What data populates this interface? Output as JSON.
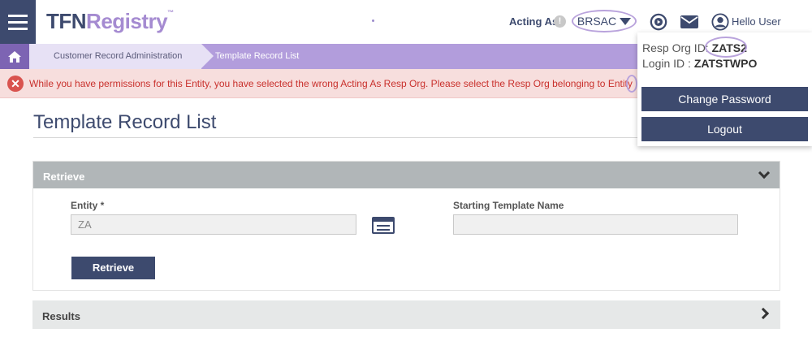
{
  "header": {
    "logo_tfn": "TFN",
    "logo_registry": "Registry",
    "logo_tm": "™",
    "acting_as_label": "Acting As",
    "acting_as_info": "!",
    "acting_as_value": "BRSAC",
    "greeting": "Hello User",
    "icons": [
      "menu-icon",
      "play-circle-icon",
      "mail-icon",
      "user-icon",
      "info-icon",
      "chevron-down-icon"
    ]
  },
  "breadcrumb": {
    "home_icon": "home-icon",
    "items": [
      "Customer Record Administration",
      "Template Record List"
    ]
  },
  "alert": {
    "icon": "close-circle-icon",
    "message": "While you have permissions for this Entity, you have selected the wrong Acting As Resp Org. Please select the Resp Org belonging to Entity ZA."
  },
  "user_menu": {
    "resp_org_label": "Resp Org ID:",
    "resp_org_value": "ZATS2",
    "login_label": "Login ID :",
    "login_value": "ZATSTWPO",
    "change_password": "Change Password",
    "logout": "Logout"
  },
  "main": {
    "title": "Template Record List",
    "retrieve_panel": {
      "title": "Retrieve",
      "entity_label": "Entity *",
      "entity_value": "ZA",
      "starting_template_label": "Starting Template Name",
      "starting_template_value": "",
      "retrieve_button": "Retrieve"
    },
    "results_panel": {
      "title": "Results"
    }
  },
  "colors": {
    "navy": "#3d4a6e",
    "purple": "#a58bd1",
    "breadcrumb": "#b29ddc",
    "alert_bg": "#f7dedd",
    "alert_text": "#c9302c",
    "panel_header": "#b1b6b8"
  }
}
